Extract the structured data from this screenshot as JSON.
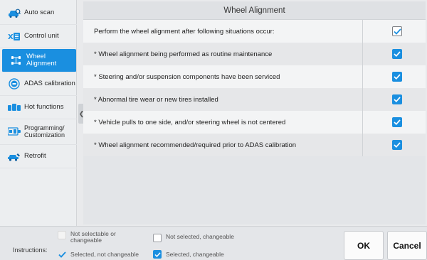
{
  "sidebar": {
    "items": [
      {
        "label": "Auto scan",
        "icon": "car-scan-icon"
      },
      {
        "label": "Control unit",
        "icon": "control-unit-icon"
      },
      {
        "label": "Wheel Alignment",
        "icon": "wheel-alignment-icon",
        "active": true
      },
      {
        "label": "ADAS calibration",
        "icon": "adas-icon"
      },
      {
        "label": "Hot functions",
        "icon": "hot-functions-icon"
      },
      {
        "label": "Programming/ Customization",
        "icon": "programming-icon"
      },
      {
        "label": "Retrofit",
        "icon": "retrofit-icon"
      }
    ]
  },
  "main": {
    "title": "Wheel Alignment",
    "rows": [
      {
        "text": "Perform the wheel alignment after following situations occur:",
        "state": "selected-fixed"
      },
      {
        "text": "* Wheel alignment being performed as routine maintenance",
        "state": "selected-changeable"
      },
      {
        "text": "* Steering and/or suspension components have been serviced",
        "state": "selected-changeable"
      },
      {
        "text": "* Abnormal tire wear or new tires installed",
        "state": "selected-changeable"
      },
      {
        "text": "* Vehicle pulls to one side, and/or steering wheel is not centered",
        "state": "selected-changeable"
      },
      {
        "text": "* Wheel alignment recommended/required prior to ADAS calibration",
        "state": "selected-changeable"
      }
    ]
  },
  "footer": {
    "instructions_label": "Instructions:",
    "legend": {
      "not_selectable": "Not selectable or changeable",
      "not_selected_changeable": "Not selected, changeable",
      "selected_not_changeable": "Selected, not changeable",
      "selected_changeable": "Selected, changeable"
    },
    "ok_label": "OK",
    "cancel_label": "Cancel"
  },
  "colors": {
    "accent": "#1a8fe0",
    "background": "#e9eaec"
  }
}
